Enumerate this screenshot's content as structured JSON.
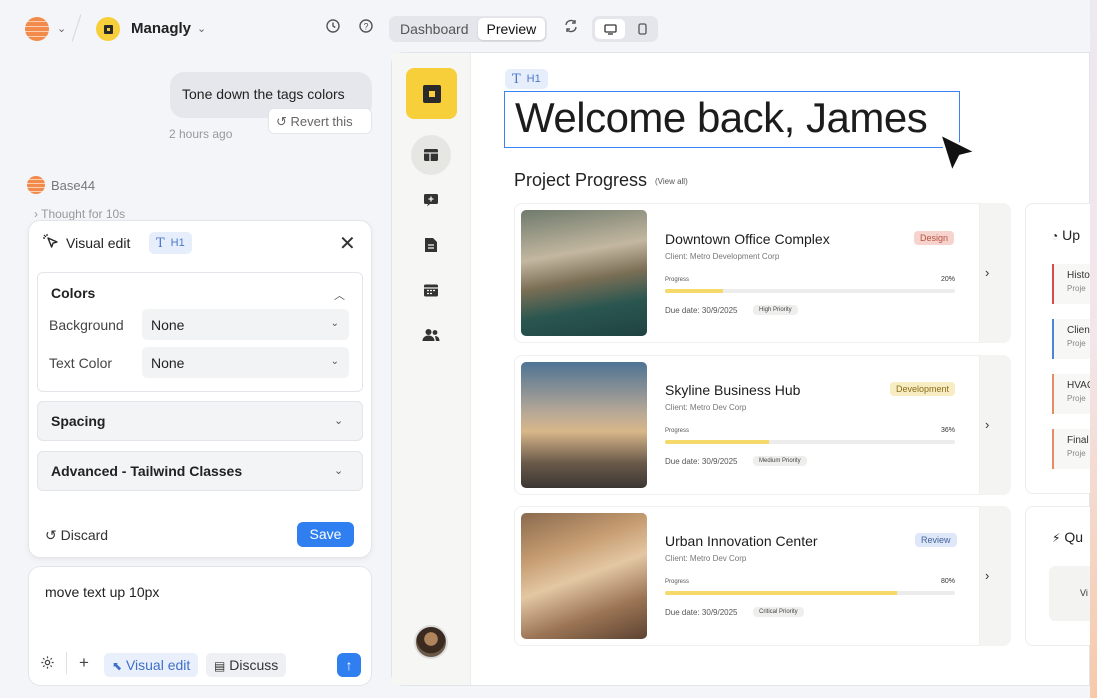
{
  "topbar": {
    "project_name": "Managly",
    "tab_dashboard": "Dashboard",
    "tab_preview": "Preview"
  },
  "chat": {
    "user_message": "Tone down the tags colors",
    "revert_label": "Revert this",
    "time_ago": "2 hours ago",
    "agent_name": "Base44",
    "thought": "Thought for 10s"
  },
  "visual_edit": {
    "title": "Visual edit",
    "tag": "H1",
    "colors_title": "Colors",
    "background_label": "Background",
    "background_value": "None",
    "text_color_label": "Text Color",
    "text_color_value": "None",
    "spacing_title": "Spacing",
    "advanced_title": "Advanced - Tailwind Classes",
    "discard_label": "Discard",
    "save_label": "Save"
  },
  "input": {
    "text": "move text up 10px",
    "visual_edit_label": "Visual edit",
    "discuss_label": "Discuss"
  },
  "preview": {
    "h1_tag": "H1",
    "welcome": "Welcome back, James",
    "section_title": "Project Progress",
    "view_all": "(View all)",
    "progress_label": "Progress",
    "projects": [
      {
        "title": "Downtown Office Complex",
        "client": "Client: Metro Development Corp",
        "badge": "Design",
        "badge_bg": "#f6d3cc",
        "badge_fg": "#b45445",
        "progress": 20,
        "pct": "20%",
        "due": "Due date: 30/9/2025",
        "priority": "High Priority"
      },
      {
        "title": "Skyline Business Hub",
        "client": "Client: Metro Dev Corp",
        "badge": "Development",
        "badge_bg": "#f8ecc2",
        "badge_fg": "#8a6d1a",
        "progress": 36,
        "pct": "36%",
        "due": "Due date: 30/9/2025",
        "priority": "Medium Priority"
      },
      {
        "title": "Urban Innovation Center",
        "client": "Client: Metro Dev Corp",
        "badge": "Review",
        "badge_bg": "#dfe8f8",
        "badge_fg": "#43639d",
        "progress": 80,
        "pct": "80%",
        "due": "Due date: 30/9/2025",
        "priority": "Critical Priority"
      }
    ],
    "upcoming_title": "Up",
    "upcoming": [
      {
        "a": "Histo",
        "b": "Proje",
        "color": "#d94b4b"
      },
      {
        "a": "Clien",
        "b": "Proje",
        "color": "#4d86d8"
      },
      {
        "a": "HVAC",
        "b": "Proje",
        "color": "#e98b62"
      },
      {
        "a": "Final",
        "b": "Proje",
        "color": "#e98b62"
      }
    ],
    "quick_title": "Qu",
    "quick_box": "Vi"
  }
}
